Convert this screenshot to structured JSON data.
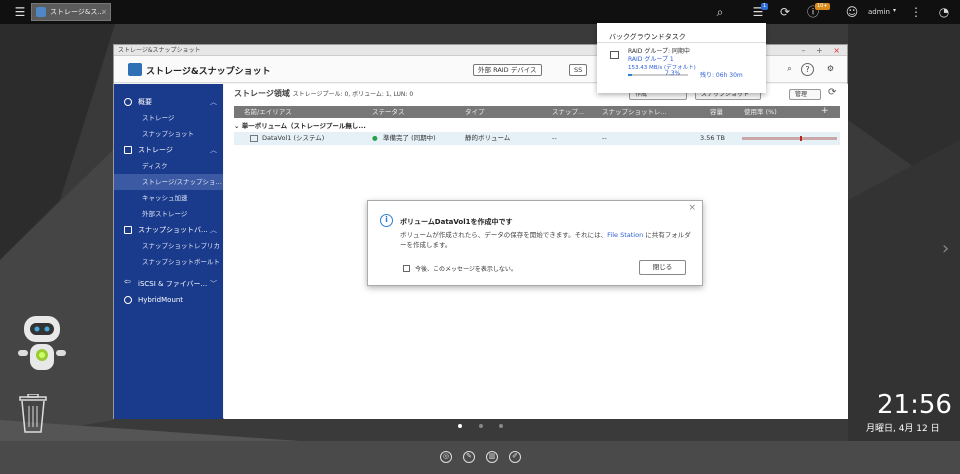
{
  "topbar": {
    "tab_label": "ストレージ&ス...",
    "user": "admin",
    "tasks_badge": "1",
    "notify_badge": "10+"
  },
  "window": {
    "title": "ストレージ&スナップショット",
    "app_name": "ストレージ&スナップショット",
    "external_raid": "外部 RAID デバイス",
    "ssd_btn": "SS"
  },
  "sidebar": {
    "overview": "概要",
    "overview_items": [
      "ストレージ",
      "スナップショット"
    ],
    "storage": "ストレージ",
    "storage_items": [
      "ディスク",
      "ストレージ/スナップショ...",
      "キャッシュ加速",
      "外部ストレージ"
    ],
    "snapshot": "スナップショットバ...",
    "snapshot_items": [
      "スナップショットレプリカ",
      "スナップショットボールト"
    ],
    "iscsi": "iSCSI & ファイバー...",
    "hybrid": "HybridMount"
  },
  "main": {
    "heading": "ストレージ領域",
    "summary": "ストレージプール: 0, ボリューム: 1, LUN: 0",
    "btn_create": "作成",
    "btn_snapshot": "スナップショット",
    "btn_manage": "管理",
    "columns": [
      "名前/エイリアス",
      "ステータス",
      "タイプ",
      "スナップ...",
      "スナップショットレ...",
      "容量",
      "使用率 (%)"
    ],
    "group": "単一ボリューム（ストレージプール無し...",
    "row": {
      "name": "DataVol1 (システム)",
      "status": "準備完了 (同期中)",
      "type": "静的ボリューム",
      "snap": "--",
      "snaprep": "--",
      "capacity": "3.56 TB"
    }
  },
  "dialog": {
    "title": "ボリュームDataVol1を作成中です",
    "message_a": "ボリュームが作成されたら、データの保存を開始できます。それには、",
    "link": "File Station",
    "message_b": "に共有フォルダーを作成します。",
    "checkbox": "今後、このメッセージを表示しない。",
    "close": "閉じる"
  },
  "background_task": {
    "title": "バックグラウンドタスク",
    "line1": "RAID グループ: 同期中",
    "line2": "RAID グループ 1",
    "line3": "153.43 MB/s (デフォルト)",
    "percent": "7.3%",
    "remaining": "残り: 06h 30m",
    "progress": 7.3
  },
  "clock": {
    "time": "21:56",
    "date": "月曜日, 4月 12 日"
  }
}
